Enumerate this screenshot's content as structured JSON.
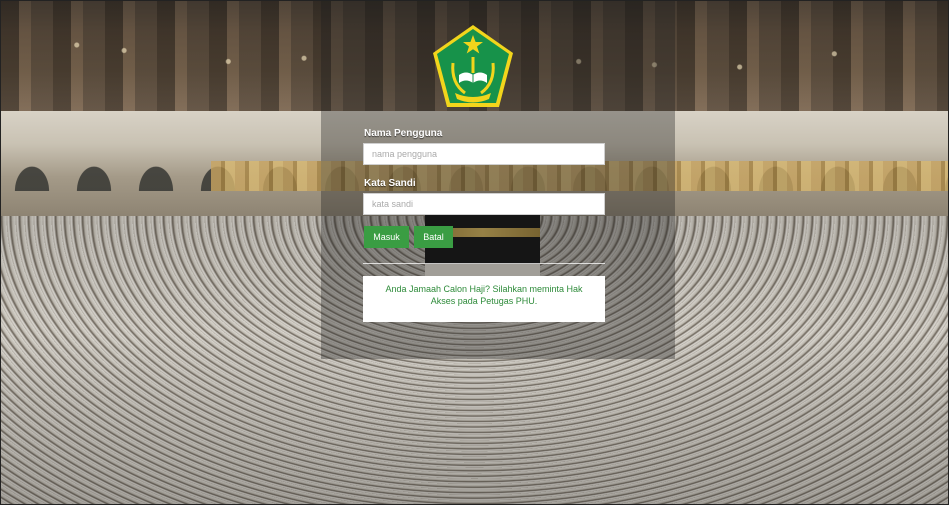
{
  "logo": {
    "icon": "kemenag-emblem-icon",
    "colors": {
      "shield": "#17924a",
      "rim": "#f2d51c",
      "star": "#f2d51c"
    }
  },
  "login": {
    "username_label": "Nama Pengguna",
    "username_placeholder": "nama pengguna",
    "username_value": "",
    "password_label": "Kata Sandi",
    "password_placeholder": "kata sandi",
    "password_value": "",
    "login_button": "Masuk",
    "cancel_button": "Batal"
  },
  "notice": {
    "text": "Anda Jamaah Calon Haji? Silahkan meminta Hak Akses pada Petugas PHU."
  },
  "theme": {
    "accent": "#3a9d43",
    "notice_text": "#2e8b3a"
  }
}
